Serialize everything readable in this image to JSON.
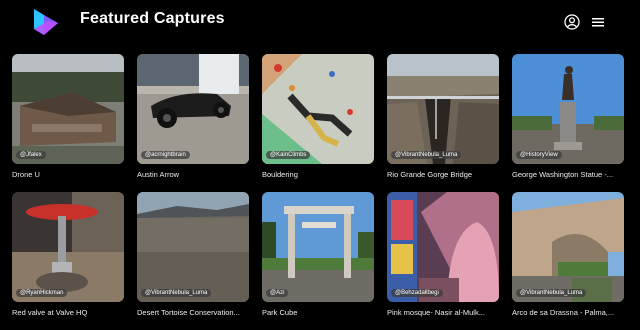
{
  "header": {
    "title": "Featured Captures",
    "brand_color": "#6a6cff"
  },
  "captures": [
    {
      "caption": "Drone U",
      "handle": "@Jfalex"
    },
    {
      "caption": "Austin Arrow",
      "handle": "@acrnightbrain"
    },
    {
      "caption": "Bouldering",
      "handle": "@KainClimbs"
    },
    {
      "caption": "Rio Grande Gorge Bridge",
      "handle": "@VibrantNebula_Luma"
    },
    {
      "caption": "George Washington Statue -...",
      "handle": "@HistoryView"
    },
    {
      "caption": "Red valve at Valve HQ",
      "handle": "@RyanHickman"
    },
    {
      "caption": "Desert Tortoise Conservation...",
      "handle": "@VibrantNebula_Luma"
    },
    {
      "caption": "Park Cube",
      "handle": "@Azi"
    },
    {
      "caption": "Pink mosque- Nasir al-Mulk...",
      "handle": "@Behzadallbegi"
    },
    {
      "caption": "Arco de sa Drassna - Palma,...",
      "handle": "@VibrantNebula_Luma"
    }
  ]
}
